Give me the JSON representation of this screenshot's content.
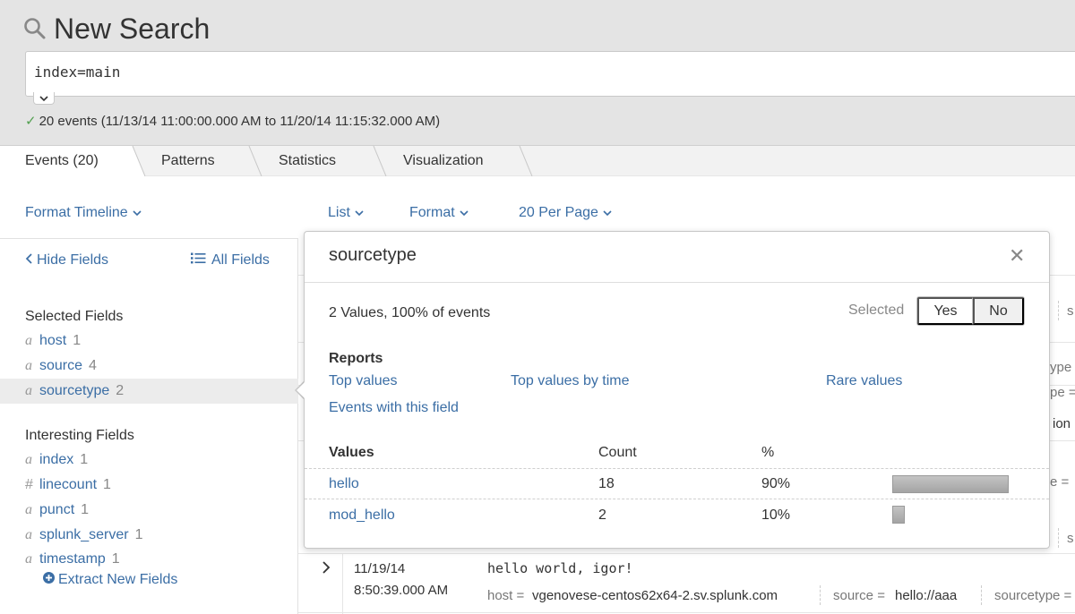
{
  "header": {
    "title": "New Search",
    "query": "index=main",
    "status": "20 events (11/13/14 11:00:00.000 AM to 11/20/14 11:15:32.000 AM)"
  },
  "tabs": [
    {
      "label": "Events (20)",
      "active": true
    },
    {
      "label": "Patterns",
      "active": false
    },
    {
      "label": "Statistics",
      "active": false
    },
    {
      "label": "Visualization",
      "active": false
    }
  ],
  "toolbar": {
    "format_timeline": "Format Timeline",
    "list": "List",
    "format": "Format",
    "per_page": "20 Per Page"
  },
  "sidebar": {
    "hide_fields": "Hide Fields",
    "all_fields": "All Fields",
    "selected_title": "Selected Fields",
    "selected_fields": [
      {
        "type": "a",
        "name": "host",
        "count": "1"
      },
      {
        "type": "a",
        "name": "source",
        "count": "4"
      },
      {
        "type": "a",
        "name": "sourcetype",
        "count": "2"
      }
    ],
    "interesting_title": "Interesting Fields",
    "interesting_fields": [
      {
        "type": "a",
        "name": "index",
        "count": "1"
      },
      {
        "type": "#",
        "name": "linecount",
        "count": "1"
      },
      {
        "type": "a",
        "name": "punct",
        "count": "1"
      },
      {
        "type": "a",
        "name": "splunk_server",
        "count": "1"
      },
      {
        "type": "a",
        "name": "timestamp",
        "count": "1"
      }
    ],
    "extract_new": "Extract New Fields"
  },
  "popover": {
    "title": "sourcetype",
    "summary": "2 Values, 100% of events",
    "selected_label": "Selected",
    "yes": "Yes",
    "no": "No",
    "reports_title": "Reports",
    "reports": {
      "top_values": "Top values",
      "top_values_by_time": "Top values by time",
      "rare_values": "Rare values",
      "events_with_field": "Events with this field"
    },
    "table_headers": {
      "values": "Values",
      "count": "Count",
      "percent": "%"
    },
    "rows": [
      {
        "value": "hello",
        "count": "18",
        "percent": "90%",
        "fraction": 0.9
      },
      {
        "value": "mod_hello",
        "count": "2",
        "percent": "10%",
        "fraction": 0.1
      }
    ]
  },
  "events": {
    "partial_right": {
      "s1": "s",
      "type_eq": "ype =",
      "ion": "ion",
      "pe_eq1": "pe =",
      "e_eq": "e =",
      "pe_eq2": "pe =",
      "s2": "s"
    },
    "last": {
      "date": "11/19/14",
      "time": "8:50:39.000 AM",
      "raw": "hello world, igor!",
      "host_key": "host =",
      "host_val": "vgenovese-centos62x64-2.sv.splunk.com",
      "source_key": "source =",
      "source_val": "hello://aaa",
      "sourcetype_key": "sourcetype ="
    }
  }
}
